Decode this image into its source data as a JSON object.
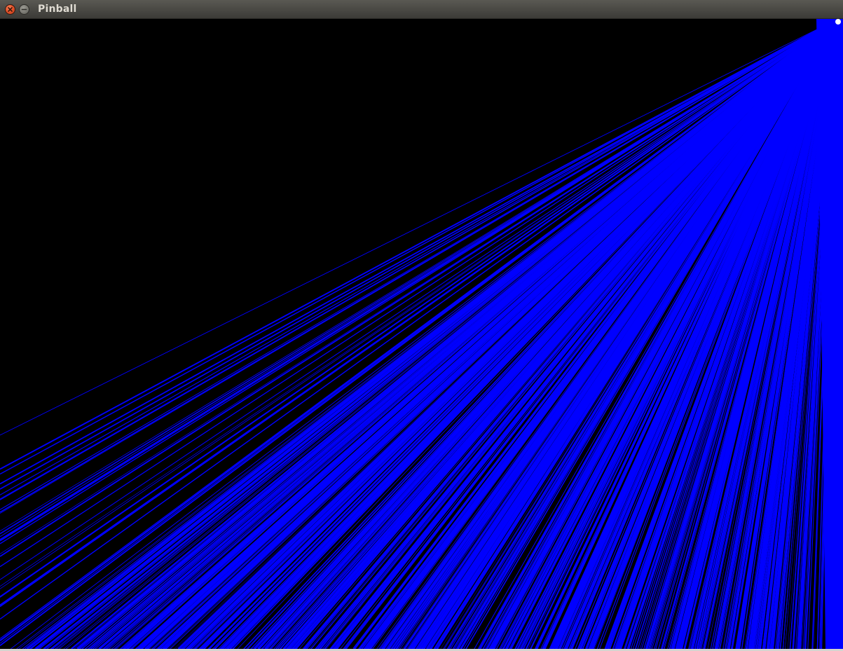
{
  "window": {
    "title": "Pinball"
  },
  "colors": {
    "background": "#000000",
    "trail": "#0000ff",
    "ball": "#ffffff"
  },
  "icons": {
    "close": "close-icon",
    "minimize": "minimize-icon"
  }
}
